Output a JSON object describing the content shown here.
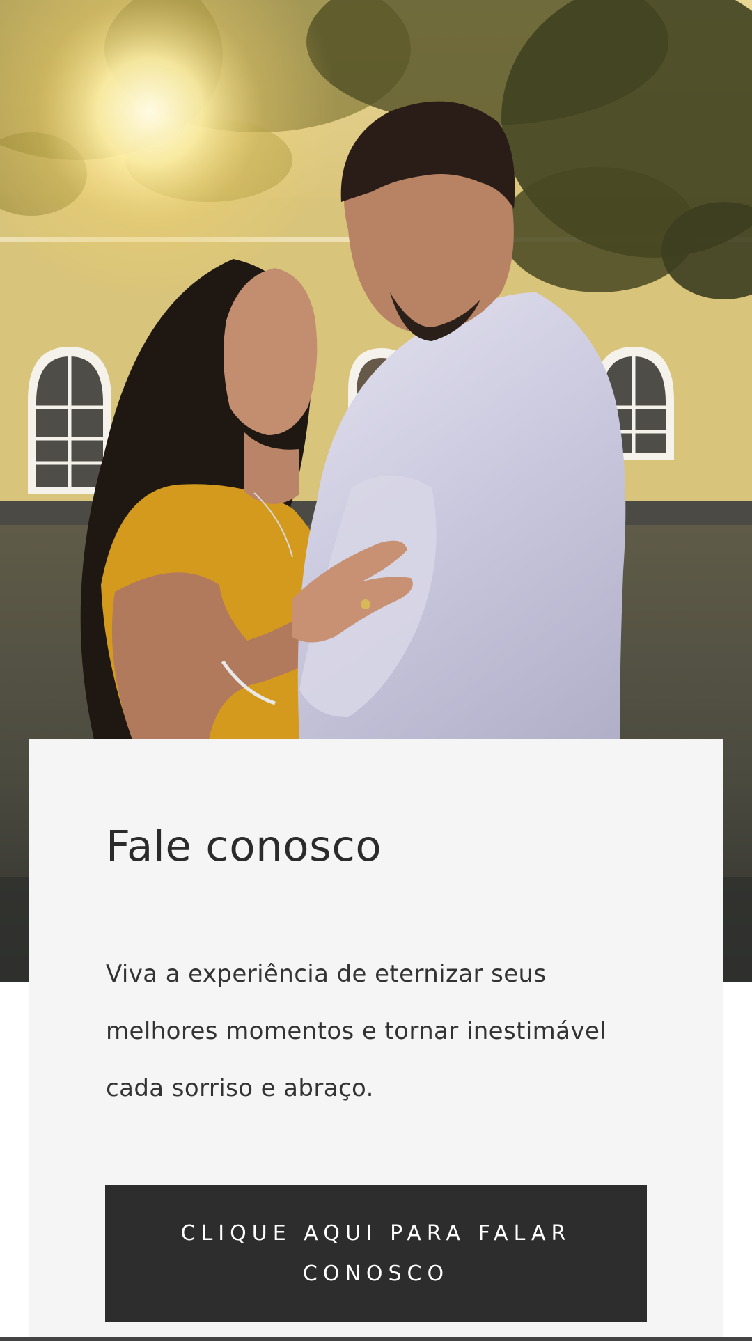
{
  "hero": {
    "image_alt": "Casal sorrindo ao ar livre em frente a um prédio amarelo"
  },
  "contact_card": {
    "title": "Fale conosco",
    "description": "Viva a experiência de eternizar seus melhores momentos e tornar inestimável cada sorriso e abraço.",
    "cta_label": "CLIQUE AQUI PARA FALAR CONOSCO"
  },
  "colors": {
    "card_background": "#f5f5f5",
    "button_background": "#2d2d2d",
    "button_text": "#ffffff",
    "text_primary": "#2b2b2b"
  }
}
